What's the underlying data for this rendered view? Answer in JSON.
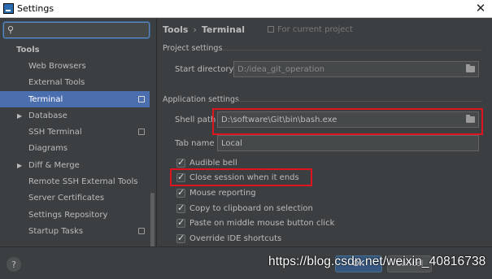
{
  "window": {
    "title": "Settings",
    "close_glyph": "✕"
  },
  "search": {
    "value": "",
    "placeholder": "",
    "icon": "search-icon"
  },
  "sidebar": {
    "items": [
      {
        "label": "Tools",
        "kind": "header"
      },
      {
        "label": "Web Browsers"
      },
      {
        "label": "External Tools"
      },
      {
        "label": "Terminal",
        "selected": true,
        "project_icon": true
      },
      {
        "label": "Database",
        "expandable": true
      },
      {
        "label": "SSH Terminal",
        "project_icon": true
      },
      {
        "label": "Diagrams"
      },
      {
        "label": "Diff & Merge",
        "expandable": true
      },
      {
        "label": "Remote SSH External Tools"
      },
      {
        "label": "Server Certificates"
      },
      {
        "label": "Settings Repository"
      },
      {
        "label": "Startup Tasks",
        "project_icon": true
      }
    ]
  },
  "breadcrumb": {
    "parent": "Tools",
    "separator": "›",
    "current": "Terminal",
    "scope": "For current project"
  },
  "project_settings": {
    "title": "Project settings",
    "start_directory": {
      "label": "Start directory",
      "value": "D:/idea_git_operation"
    }
  },
  "application_settings": {
    "title": "Application settings",
    "shell_path": {
      "label": "Shell path",
      "value": "D:\\software\\Git\\bin\\bash.exe"
    },
    "tab_name": {
      "label": "Tab name",
      "value": "Local"
    },
    "checkboxes": [
      {
        "label": "Audible bell",
        "checked": true
      },
      {
        "label": "Close session when it ends",
        "checked": true
      },
      {
        "label": "Mouse reporting",
        "checked": true
      },
      {
        "label": "Copy to clipboard on selection",
        "checked": true
      },
      {
        "label": "Paste on middle mouse button click",
        "checked": true
      },
      {
        "label": "Override IDE shortcuts",
        "checked": true
      }
    ]
  },
  "footer": {
    "help_label": "?",
    "ok_label": "OK",
    "cancel_label": "Cancel",
    "watermark": "https://blog.csdn.net/weixin_40816738"
  },
  "colors": {
    "background": "#3c3f41",
    "selection": "#4b6eaf",
    "ok_button": "#365880",
    "highlight": "#e0141e"
  }
}
